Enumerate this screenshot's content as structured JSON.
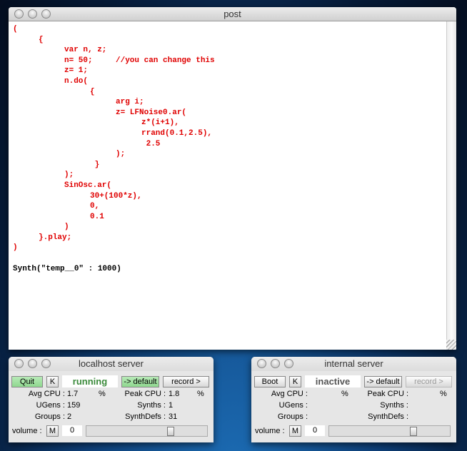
{
  "post": {
    "title": "post",
    "code_lines": [
      "(",
      "\t{",
      "\t\tvar n, z;",
      "\t\tn= 50;\t//you can change this",
      "\t\tz= 1;",
      "\t\tn.do(",
      "\t\t\t{",
      "\t\t\t\targ i;",
      "\t\t\t\tz= LFNoise0.ar(",
      "\t\t\t\t\tz*(i+1),",
      "\t\t\t\t\trrand(0.1,2.5),",
      "\t\t\t\t\t 2.5",
      "\t\t\t\t);",
      "\t\t\t }",
      "\t\t);",
      "\t\tSinOsc.ar(",
      "\t\t\t30+(100*z),",
      "\t\t\t0,",
      "\t\t\t0.1",
      "\t\t)",
      "\t}.play;",
      ")"
    ],
    "result": "Synth(\"temp__0\" : 1000)"
  },
  "localhost": {
    "title": "localhost server",
    "boot": "Quit",
    "kill": "K",
    "status": "running",
    "status_color": "#3a8a3a",
    "default": "-> default",
    "record": "record >",
    "avg_cpu_label": "Avg CPU :",
    "avg_cpu": "1.7",
    "pct": "%",
    "peak_cpu_label": "Peak CPU :",
    "peak_cpu": "1.8",
    "ugens_label": "UGens :",
    "ugens": "159",
    "synths_label": "Synths :",
    "synths": "1",
    "groups_label": "Groups :",
    "groups": "2",
    "synthdefs_label": "SynthDefs :",
    "synthdefs": "31",
    "volume_label": "volume :",
    "mute": "M",
    "volume": "0"
  },
  "internal": {
    "title": "internal server",
    "boot": "Boot",
    "kill": "K",
    "status": "inactive",
    "status_color": "#555555",
    "default": "-> default",
    "record": "record >",
    "avg_cpu_label": "Avg CPU :",
    "avg_cpu": "",
    "pct": "%",
    "peak_cpu_label": "Peak CPU :",
    "peak_cpu": "",
    "ugens_label": "UGens :",
    "ugens": "",
    "synths_label": "Synths :",
    "synths": "",
    "groups_label": "Groups :",
    "groups": "",
    "synthdefs_label": "SynthDefs :",
    "synthdefs": "",
    "volume_label": "volume :",
    "mute": "M",
    "volume": "0"
  }
}
